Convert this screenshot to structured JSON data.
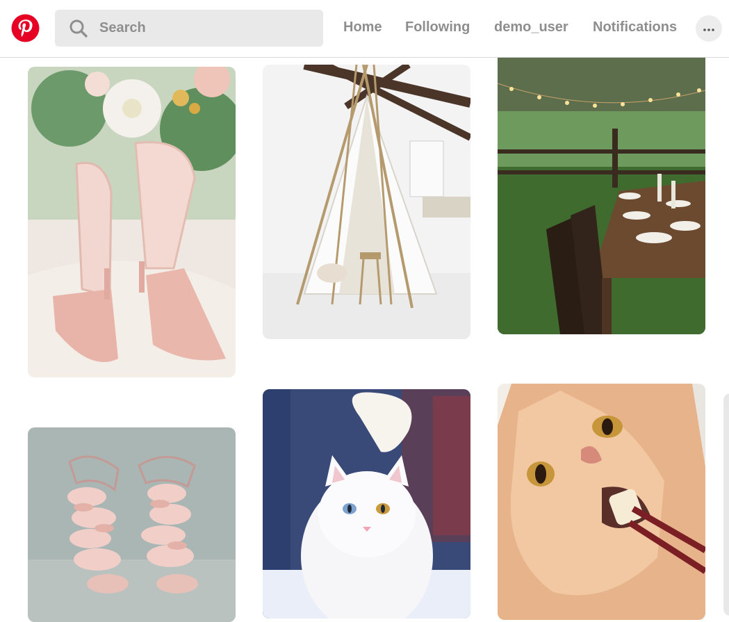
{
  "header": {
    "logo_icon": "pinterest-logo-icon",
    "brand_color": "#e60023",
    "search": {
      "placeholder": "Search",
      "value": "",
      "icon": "search-icon"
    },
    "nav": {
      "home": "Home",
      "following": "Following",
      "profile": "demo_user",
      "notifications": "Notifications"
    },
    "more_icon": "ellipsis-icon"
  },
  "pins": [
    {
      "subject": "pink butterfly heels with bouquet"
    },
    {
      "subject": "white teepee in bright room"
    },
    {
      "subject": "outdoor dinner table with string lights"
    },
    {
      "subject": "pink ruffle sandals"
    },
    {
      "subject": "white fluffy cat"
    },
    {
      "subject": "orange cat eating with chopsticks"
    }
  ]
}
